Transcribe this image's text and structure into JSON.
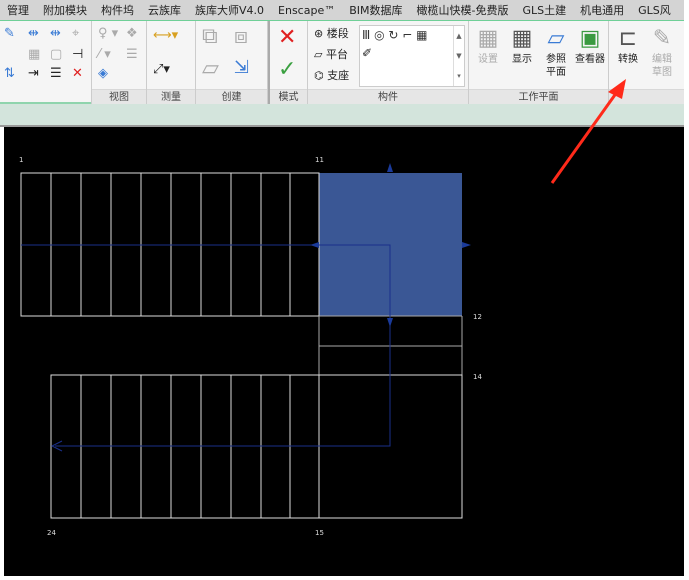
{
  "tabs": [
    "管理",
    "附加模块",
    "构件坞",
    "云族库",
    "族库大师V4.0",
    "Enscape™",
    "BIM数据库",
    "橄榄山快模-免费版",
    "GLS土建",
    "机电通用",
    "GLS风"
  ],
  "panels": {
    "view": "视图",
    "measure": "测量",
    "create": "创建",
    "mode": "模式",
    "component": "构件",
    "workplane": "工作平面"
  },
  "component_items": [
    "楼段",
    "平台",
    "支座"
  ],
  "workplane_buttons": [
    "设置",
    "显示",
    "参照\n平面",
    "查看器"
  ],
  "convert_label": "转换",
  "edit_sketch_label": "编辑\n草图",
  "drawing_labels": {
    "n1": "1",
    "n11": "11",
    "n12": "12",
    "n14": "14",
    "n24": "24",
    "n15": "15"
  },
  "colors": {
    "landing": "#3a5795",
    "path": "#1a2f8a",
    "annot": "#ff2a1a"
  }
}
